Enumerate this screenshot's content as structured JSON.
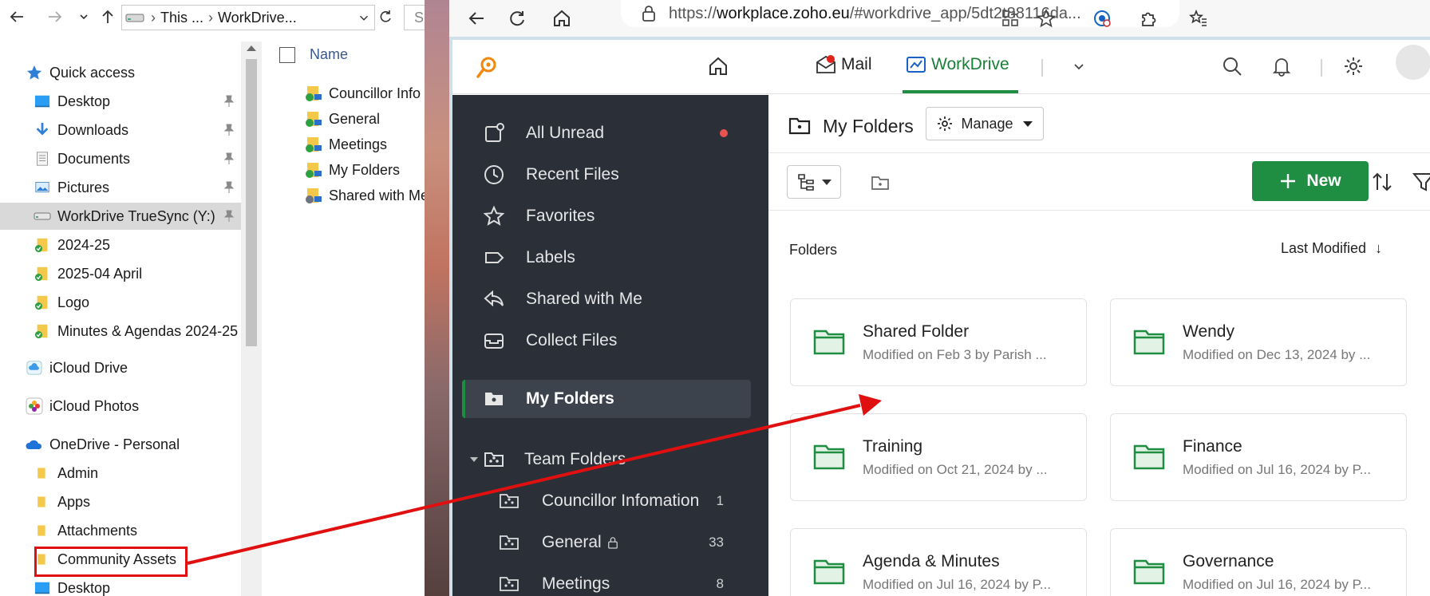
{
  "explorer": {
    "address": {
      "segment1": "This ...",
      "segment2": "WorkDrive..."
    },
    "search_placeholder": "S",
    "nav": [
      {
        "label": "Quick access"
      },
      {
        "label": "Desktop"
      },
      {
        "label": "Downloads"
      },
      {
        "label": "Documents"
      },
      {
        "label": "Pictures"
      },
      {
        "label": "WorkDrive TrueSync (Y:)"
      },
      {
        "label": "2024-25"
      },
      {
        "label": "2025-04 April"
      },
      {
        "label": "Logo"
      },
      {
        "label": "Minutes & Agendas 2024-25"
      },
      {
        "label": "iCloud Drive"
      },
      {
        "label": "iCloud Photos"
      },
      {
        "label": "OneDrive - Personal"
      },
      {
        "label": "Admin"
      },
      {
        "label": "Apps"
      },
      {
        "label": "Attachments"
      },
      {
        "label": "Community Assets"
      },
      {
        "label": "Desktop"
      }
    ],
    "files_header": "Name",
    "files": [
      {
        "label": "Councillor Info"
      },
      {
        "label": "General"
      },
      {
        "label": "Meetings"
      },
      {
        "label": "My Folders"
      },
      {
        "label": "Shared with Me"
      }
    ]
  },
  "browser": {
    "url_prefix": "https://",
    "url_host": "workplace.zoho.eu",
    "url_path": "/#workdrive_app/5dt2t88116da..."
  },
  "zoho": {
    "apps": {
      "mail": "Mail",
      "workdrive": "WorkDrive"
    },
    "sidebar": {
      "items": [
        {
          "label": "All Unread"
        },
        {
          "label": "Recent Files"
        },
        {
          "label": "Favorites"
        },
        {
          "label": "Labels"
        },
        {
          "label": "Shared with Me"
        },
        {
          "label": "Collect Files"
        },
        {
          "label": "My Folders"
        },
        {
          "label": "Team Folders"
        }
      ],
      "team_folders": [
        {
          "label": "Councillor Infomation",
          "count": "1"
        },
        {
          "label": "General",
          "count": "33"
        },
        {
          "label": "Meetings",
          "count": "8"
        }
      ]
    },
    "main": {
      "title": "My Folders",
      "manage_label": "Manage",
      "new_label": "New",
      "section_label": "Folders",
      "sort_label": "Last Modified",
      "cards": [
        {
          "title": "Shared Folder",
          "meta": "Modified on Feb 3 by Parish ..."
        },
        {
          "title": "Wendy",
          "meta": "Modified on Dec 13, 2024 by ..."
        },
        {
          "title": "Training",
          "meta": "Modified on Oct 21, 2024 by ..."
        },
        {
          "title": "Finance",
          "meta": "Modified on Jul 16, 2024 by P..."
        },
        {
          "title": "Agenda & Minutes",
          "meta": "Modified on Jul 16, 2024 by P..."
        },
        {
          "title": "Governance",
          "meta": "Modified on Jul 16, 2024 by P..."
        }
      ]
    }
  },
  "colors": {
    "workdrive_green": "#1f8e42",
    "sidebar_bg": "#2a2f38",
    "annotation_red": "#e01010",
    "unread_dot": "#e9534f"
  },
  "icons": {
    "nav": [
      "star-icon",
      "desktop-icon",
      "download-icon",
      "documents-icon",
      "pictures-icon",
      "drive-icon",
      "folder-synced-icon",
      "cloud-icon",
      "photos-icon",
      "onedrive-icon",
      "folder-icon"
    ],
    "sidebar": [
      "unread-icon",
      "clock-icon",
      "star-icon",
      "label-icon",
      "share-icon",
      "collect-icon",
      "folder-icon",
      "team-folder-icon"
    ]
  }
}
